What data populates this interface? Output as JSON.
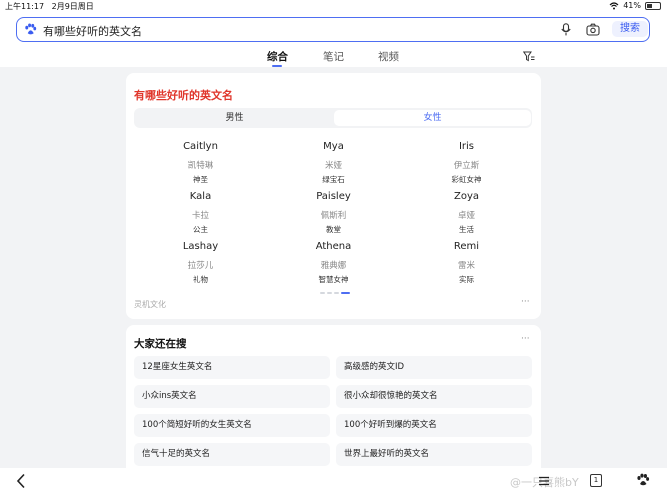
{
  "status": {
    "time": "上午11:17",
    "date": "2月9日周日",
    "battery": "41%",
    "battery_level": 0.41
  },
  "search": {
    "query": "有哪些好听的英文名",
    "button": "搜索"
  },
  "tabs": [
    {
      "label": "综合"
    },
    {
      "label": "笔记"
    },
    {
      "label": "视频"
    }
  ],
  "card": {
    "title": "有哪些好听的英文名",
    "gender_options": [
      "男性",
      "女性"
    ],
    "selected_gender": "女性",
    "names": [
      {
        "en": "Caitlyn",
        "cn": "凯特琳",
        "meaning": "神圣"
      },
      {
        "en": "Mya",
        "cn": "米娅",
        "meaning": "绿宝石"
      },
      {
        "en": "Iris",
        "cn": "伊立斯",
        "meaning": "彩虹女神"
      },
      {
        "en": "Kala",
        "cn": "卡拉",
        "meaning": "公主"
      },
      {
        "en": "Paisley",
        "cn": "佩斯利",
        "meaning": "教堂"
      },
      {
        "en": "Zoya",
        "cn": "卓娅",
        "meaning": "生活"
      },
      {
        "en": "Lashay",
        "cn": "拉莎儿",
        "meaning": "礼物"
      },
      {
        "en": "Athena",
        "cn": "雅典娜",
        "meaning": "智慧女神"
      },
      {
        "en": "Remi",
        "cn": "雷米",
        "meaning": "实际"
      }
    ],
    "source": "灵机文化",
    "more": "···",
    "page_count": 4,
    "current_page": 4
  },
  "related": {
    "title": "大家还在搜",
    "more": "···",
    "items": [
      "12星座女生英文名",
      "高级感的英文ID",
      "小众ins英文名",
      "很小众却很惊艳的英文名",
      "100个简短好听的女生英文名",
      "100个好听到爆的英文名",
      "信气十足的英文名",
      "世界上最好听的英文名"
    ]
  },
  "bottom": {
    "watermark": "@一只喜熊bY",
    "tabs_count": "1"
  },
  "colors": {
    "accent": "#4e6ef2",
    "title_red": "#e0362b",
    "background": "#f2f3f5"
  }
}
